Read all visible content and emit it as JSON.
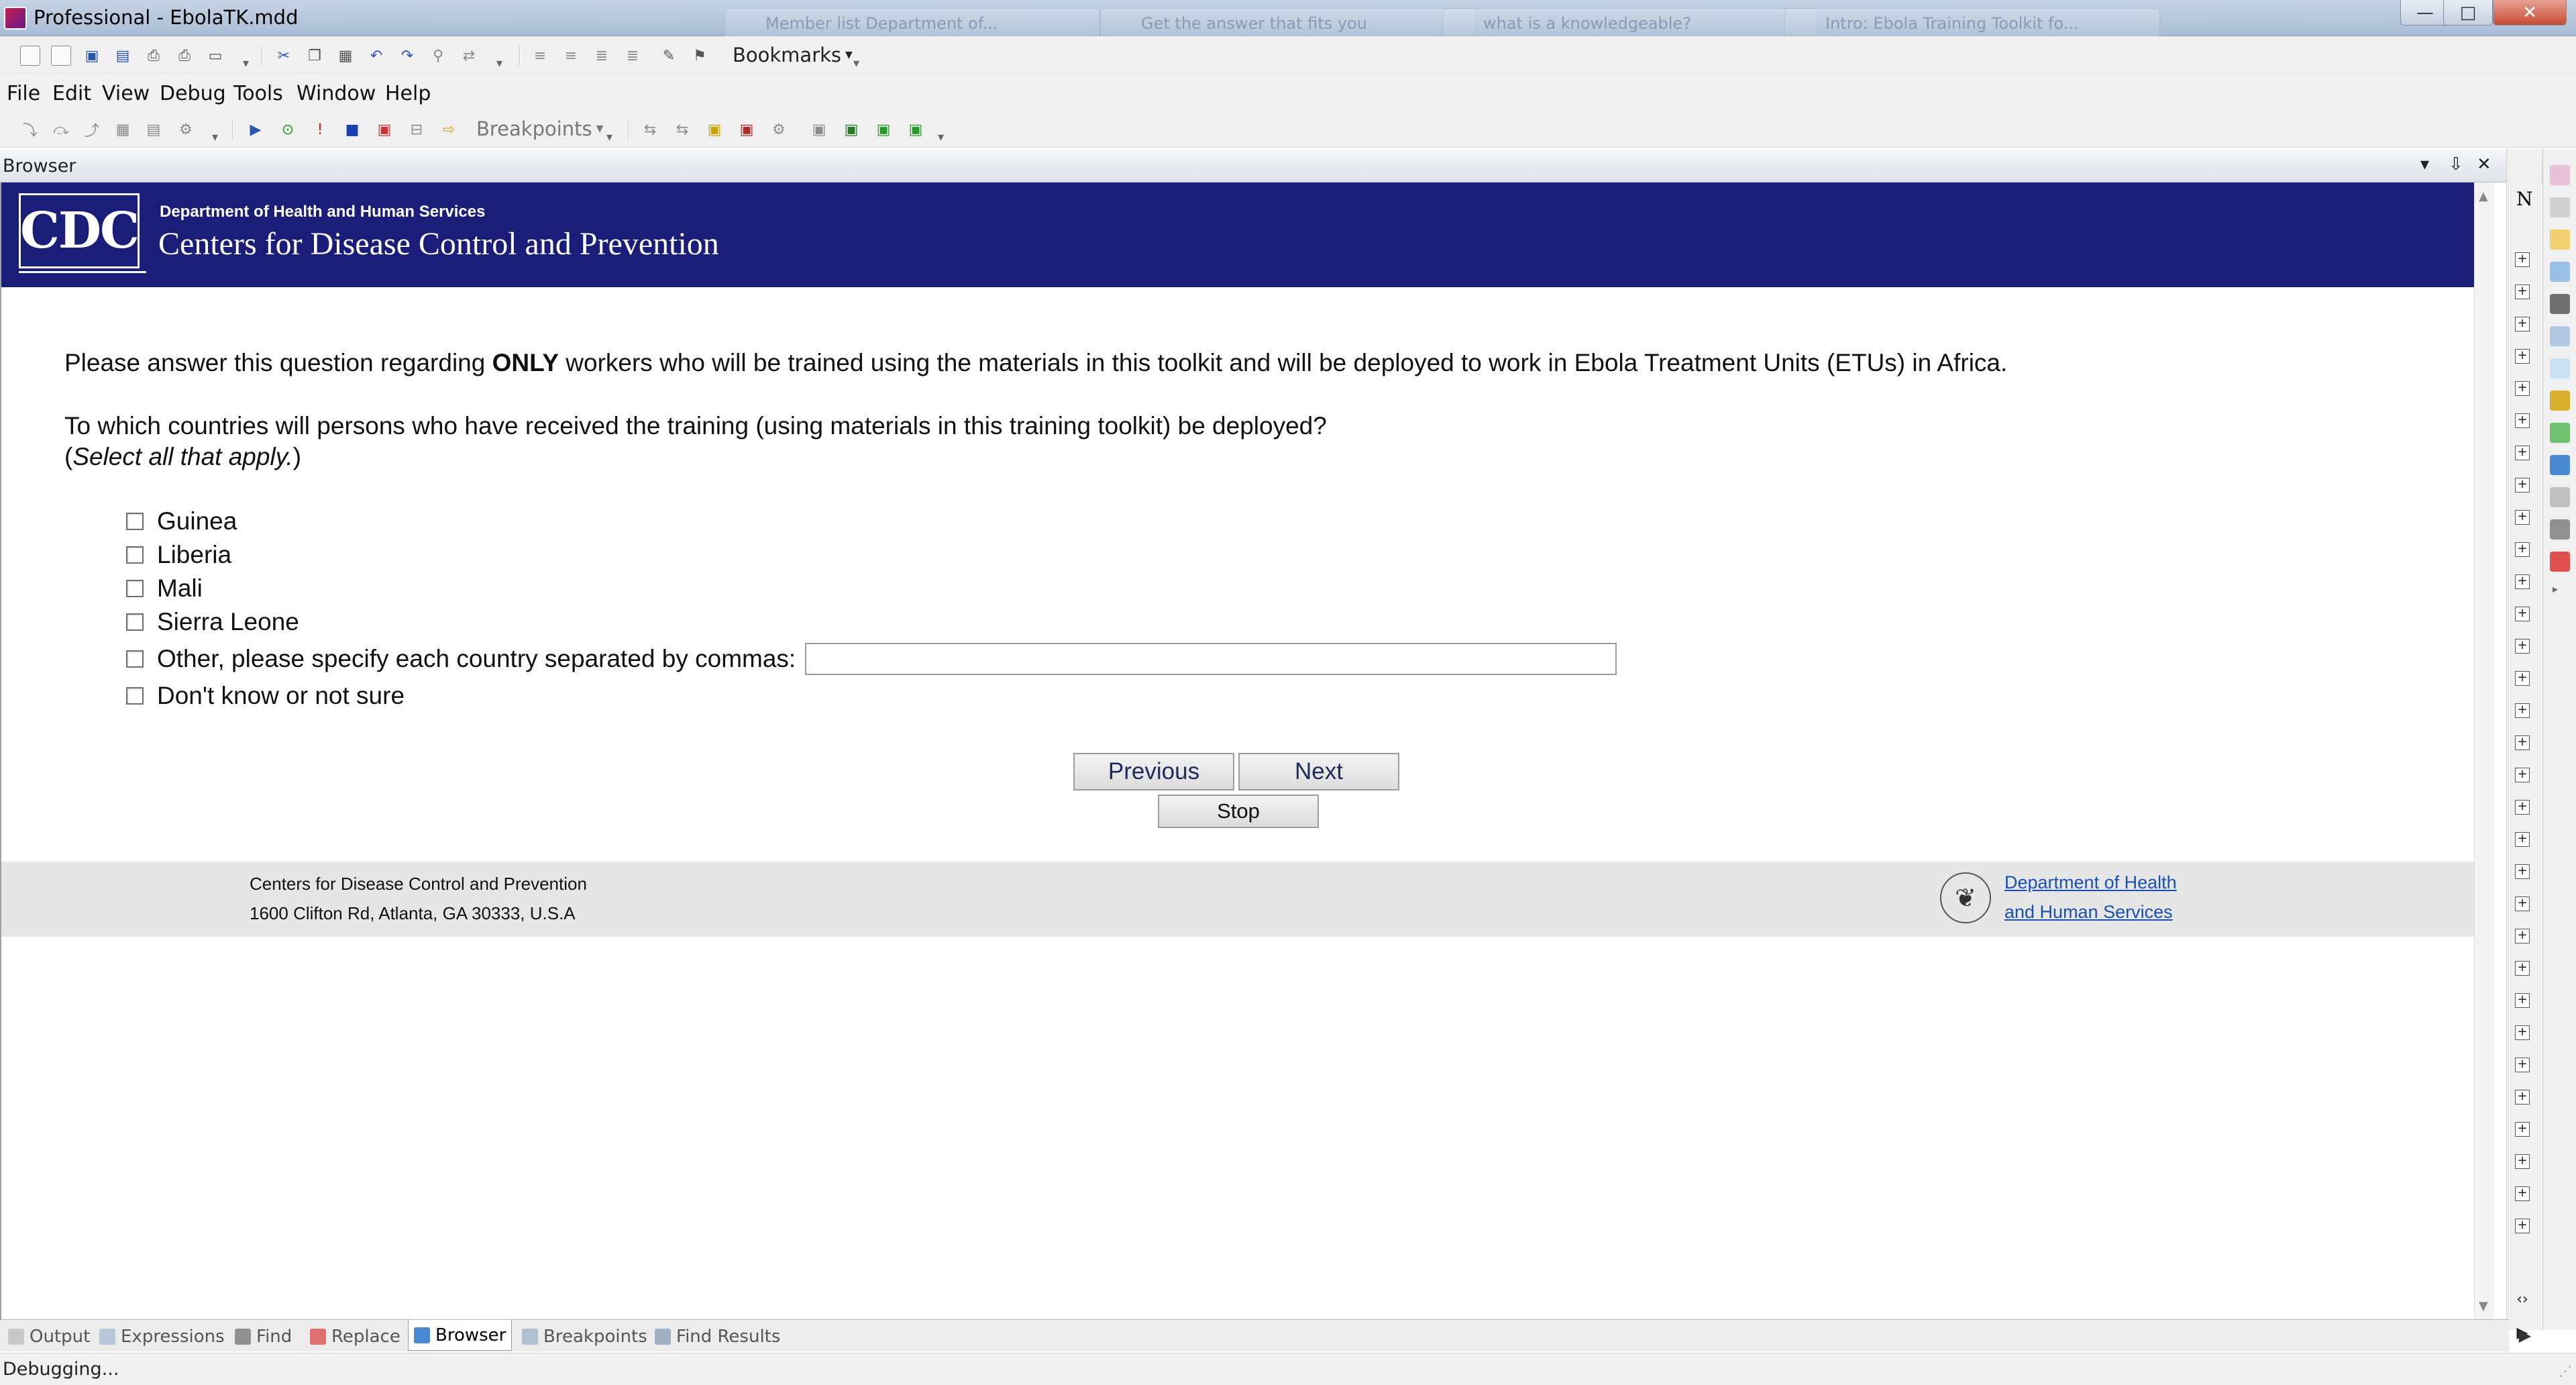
{
  "window": {
    "title": "Professional - EbolaTK.mdd",
    "background_tabs": [
      "Member list Department of...",
      "Get the answer that fits you",
      "what is a knowledgeable?",
      "Intro: Ebola Training Toolkit fo..."
    ],
    "controls": {
      "minimize": "—",
      "maximize": "□",
      "close": "✕"
    }
  },
  "toolbar1": {
    "bookmarks_label": "Bookmarks"
  },
  "menu": {
    "items": [
      "File",
      "Edit",
      "View",
      "Debug",
      "Tools",
      "Window",
      "Help"
    ]
  },
  "toolbar2": {
    "breakpoints_label": "Breakpoints"
  },
  "pane": {
    "title": "Browser",
    "controls": {
      "dropdown": "▾",
      "pin": "⇩",
      "close": "✕"
    }
  },
  "cdc": {
    "logo_text": "CDC",
    "department": "Department of Health and Human Services",
    "organization": "Centers for Disease Control and Prevention"
  },
  "survey": {
    "intro_before": "Please answer this question regarding ",
    "intro_bold": "ONLY",
    "intro_after": " workers who will be trained using the materials in this toolkit and will be deployed to work in Ebola Treatment Units (ETUs) in Africa.",
    "question": "To which countries will persons who have received the training (using materials in this training toolkit) be deployed?",
    "hint_open": "(",
    "hint_italic": "Select all that apply.",
    "hint_close": ")",
    "options": [
      {
        "label": "Guinea",
        "checked": false
      },
      {
        "label": "Liberia",
        "checked": false
      },
      {
        "label": "Mali",
        "checked": false
      },
      {
        "label": "Sierra Leone",
        "checked": false
      },
      {
        "label": "Other, please specify each country separated by commas:",
        "checked": false
      },
      {
        "label": "Don't know or not sure",
        "checked": false
      }
    ],
    "other_value": "",
    "buttons": {
      "previous": "Previous",
      "next": "Next",
      "stop": "Stop"
    }
  },
  "footer": {
    "line1": "Centers for Disease Control and Prevention",
    "line2": "1600 Clifton Rd, Atlanta, GA 30333, U.S.A",
    "hhs_link_line1": "Department of Health",
    "hhs_link_line2": "and Human Services"
  },
  "right_panel": {
    "top_label": "N"
  },
  "bottom_tabs": {
    "items": [
      "Output",
      "Expressions",
      "Find",
      "Replace",
      "Browser",
      "Breakpoints",
      "Find Results"
    ],
    "active": "Browser"
  },
  "status": {
    "text": "Debugging..."
  },
  "colors": {
    "cdc_banner": "#1b1e78",
    "footer_bg": "#e6e6e6",
    "link": "#1a4fb5",
    "nav_button_text": "#1c2a5c"
  }
}
